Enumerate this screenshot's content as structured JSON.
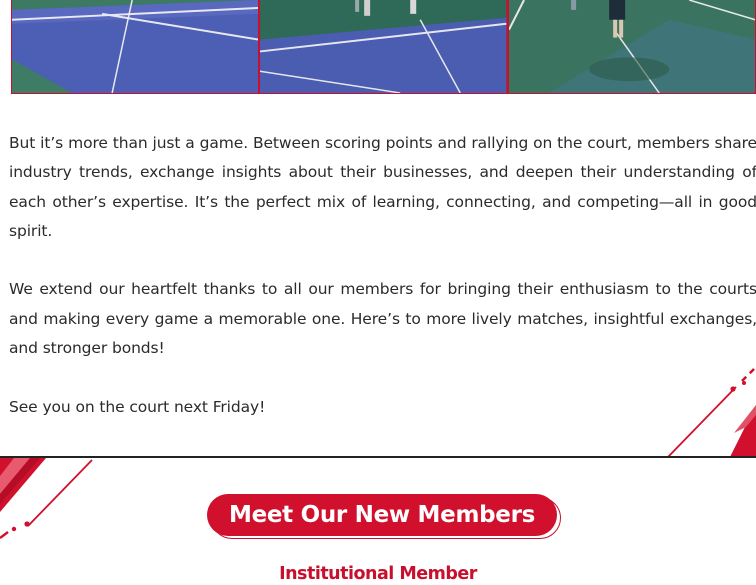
{
  "article": {
    "paragraphs": [
      "But it’s more than just a game. Between scoring points and rallying on the court, members share industry trends, exchange insights about their businesses, and deepen their understanding of each other’s expertise. It’s the perfect mix of learning, connecting, and competing—all in good spirit.",
      "We extend our heartfelt thanks to all our members for bringing their enthusiasm to the courts and making every game a memorable one. Here’s to more lively matches, insightful exchanges, and stronger bonds!",
      "See you on the court next Friday!"
    ]
  },
  "section": {
    "title": "Meet Our New Members",
    "subhead": "Institutional Member"
  },
  "colors": {
    "accent": "#c8102e",
    "text": "#2b2b2b",
    "court_blue": "#4a5fb0",
    "court_green": "#3f7f6a"
  }
}
